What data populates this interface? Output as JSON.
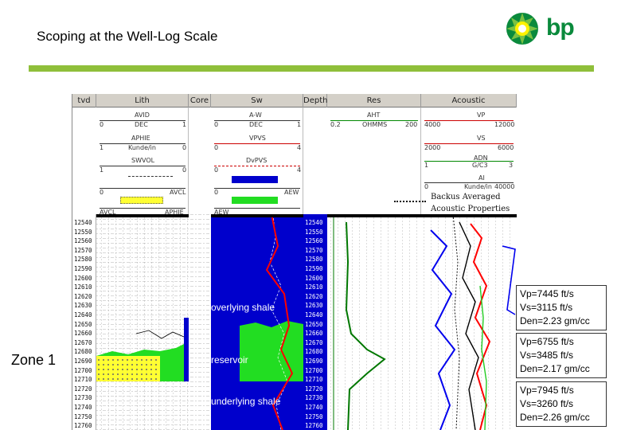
{
  "title": "Scoping at the Well-Log Scale",
  "logo": {
    "text": "bp",
    "icon": "bp-helios-icon"
  },
  "headers": [
    "tvd",
    "Lith",
    "Core",
    "Sw",
    "Depth",
    "Res",
    "Acoustic"
  ],
  "track_headers": {
    "lith": [
      {
        "name": "AVID",
        "left": "0",
        "unit": "DEC",
        "right": "1"
      },
      {
        "name": "APHIE",
        "left": "1",
        "unit": "Kunde/in",
        "right": "0"
      },
      {
        "name": "SWVOL",
        "left": "1",
        "unit": "",
        "right": "0"
      },
      {
        "name": "AVCL",
        "left": "0",
        "unit": "",
        "right": ""
      },
      {
        "name": "AVCL",
        "left": "",
        "unit": "",
        "right": "APHIE"
      }
    ],
    "sw": [
      {
        "name": "A-W",
        "left": "0",
        "unit": "DEC",
        "right": "1"
      },
      {
        "name": "VPVS",
        "left": "0",
        "unit": "",
        "right": "4"
      },
      {
        "name": "DvPVS",
        "left": "0",
        "unit": "",
        "right": "4"
      },
      {
        "name": "AEW",
        "left": "0",
        "unit": "",
        "right": ""
      },
      {
        "name": "",
        "left": "AEW",
        "unit": "",
        "right": ""
      }
    ],
    "res": [
      {
        "name": "AHT",
        "left": "0.2",
        "unit": "OHMMS",
        "right": "200"
      }
    ],
    "acoustic": [
      {
        "name": "VP",
        "left": "4000",
        "unit": "",
        "right": "12000"
      },
      {
        "name": "VS",
        "left": "2000",
        "unit": "",
        "right": "6000"
      },
      {
        "name": "ADN",
        "left": "1",
        "unit": "G/C3",
        "right": "3"
      },
      {
        "name": "AI",
        "left": "0",
        "unit": "Kunde/in",
        "right": "40000"
      }
    ]
  },
  "backus_label_1": "Backus Averaged",
  "backus_label_2": "Acoustic Properties",
  "depths": [
    "12540",
    "12550",
    "12560",
    "12570",
    "12580",
    "12590",
    "12600",
    "12610",
    "12620",
    "12630",
    "12640",
    "12650",
    "12660",
    "12670",
    "12680",
    "12690",
    "12700",
    "12710",
    "12720",
    "12730",
    "12740",
    "12750",
    "12760"
  ],
  "annotations": {
    "overlying": "overlying shale",
    "reservoir": "reservoir",
    "underlying": "underlying shale"
  },
  "zone_label": "Zone 1",
  "properties": [
    {
      "vp": "Vp=7445 ft/s",
      "vs": "Vs=3115 ft/s",
      "den": "Den=2.23 gm/cc"
    },
    {
      "vp": "Vp=6755 ft/s",
      "vs": "Vs=3485 ft/s",
      "den": "Den=2.17 gm/cc"
    },
    {
      "vp": "Vp=7945 ft/s",
      "vs": "Vs=3260 ft/s",
      "den": "Den=2.26 gm/cc"
    }
  ],
  "colors": {
    "green_bar": "#8fbf3a",
    "sw_blue": "#0000cc",
    "reservoir_green": "#22dd22",
    "sand_yellow": "#ffff33"
  }
}
